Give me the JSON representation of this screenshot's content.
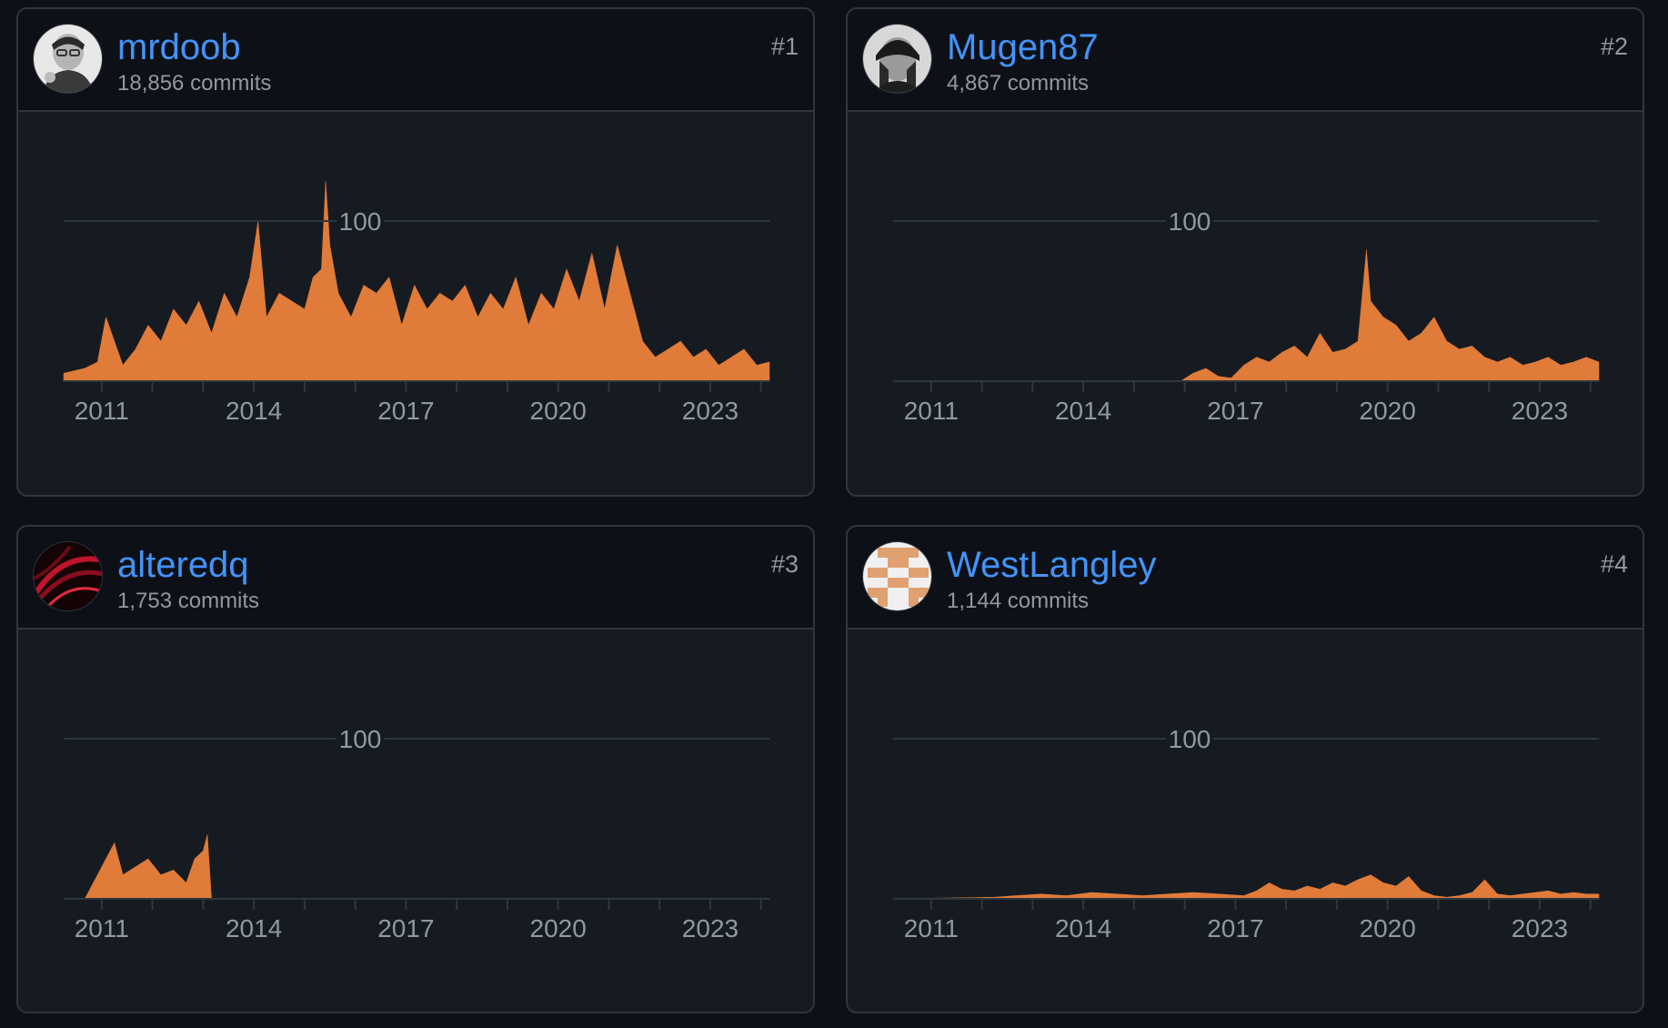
{
  "contributors": [
    {
      "rank": "#1",
      "username": "mrdoob",
      "commits": "18,856 commits",
      "avatar_icon": "avatar-photo-man-glasses"
    },
    {
      "rank": "#2",
      "username": "Mugen87",
      "commits": "4,867 commits",
      "avatar_icon": "avatar-photo-man-beanie"
    },
    {
      "rank": "#3",
      "username": "alteredq",
      "commits": "1,753 commits",
      "avatar_icon": "avatar-red-abstract"
    },
    {
      "rank": "#4",
      "username": "WestLangley",
      "commits": "1,144 commits",
      "avatar_icon": "avatar-identicon-orange"
    }
  ],
  "chart_data": [
    {
      "type": "area",
      "title": "mrdoob",
      "x_ticks": [
        "2011",
        "2014",
        "2017",
        "2020",
        "2023"
      ],
      "y_ticks": [
        "100"
      ],
      "ylim": [
        0,
        100
      ],
      "xlim": [
        "2010-04",
        "2024-03"
      ],
      "grid": true,
      "color": "#e07b39",
      "x": [
        "2010-04",
        "2010-09",
        "2010-12",
        "2011-02",
        "2011-06",
        "2011-09",
        "2011-12",
        "2012-03",
        "2012-06",
        "2012-09",
        "2012-12",
        "2013-03",
        "2013-06",
        "2013-09",
        "2013-12",
        "2014-02",
        "2014-04",
        "2014-07",
        "2014-10",
        "2015-01",
        "2015-03",
        "2015-05",
        "2015-06",
        "2015-07",
        "2015-09",
        "2015-12",
        "2016-03",
        "2016-06",
        "2016-09",
        "2016-12",
        "2017-03",
        "2017-06",
        "2017-09",
        "2017-12",
        "2018-03",
        "2018-06",
        "2018-09",
        "2018-12",
        "2019-03",
        "2019-06",
        "2019-09",
        "2019-12",
        "2020-03",
        "2020-06",
        "2020-09",
        "2020-12",
        "2021-03",
        "2021-06",
        "2021-09",
        "2021-12",
        "2022-03",
        "2022-06",
        "2022-09",
        "2022-12",
        "2023-03",
        "2023-06",
        "2023-09",
        "2023-12",
        "2024-03"
      ],
      "values": [
        5,
        8,
        12,
        40,
        10,
        20,
        35,
        25,
        45,
        35,
        50,
        30,
        55,
        40,
        65,
        100,
        40,
        55,
        50,
        45,
        65,
        70,
        125,
        85,
        55,
        40,
        60,
        55,
        65,
        35,
        60,
        45,
        55,
        50,
        60,
        40,
        55,
        45,
        65,
        35,
        55,
        45,
        70,
        50,
        80,
        45,
        85,
        55,
        25,
        15,
        20,
        25,
        15,
        20,
        10,
        15,
        20,
        10,
        12
      ]
    },
    {
      "type": "area",
      "title": "Mugen87",
      "x_ticks": [
        "2011",
        "2014",
        "2017",
        "2020",
        "2023"
      ],
      "y_ticks": [
        "100"
      ],
      "ylim": [
        0,
        100
      ],
      "xlim": [
        "2010-04",
        "2024-03"
      ],
      "grid": true,
      "color": "#e07b39",
      "x": [
        "2010-04",
        "2015-12",
        "2016-03",
        "2016-06",
        "2016-09",
        "2016-12",
        "2017-03",
        "2017-06",
        "2017-09",
        "2017-12",
        "2018-03",
        "2018-06",
        "2018-09",
        "2018-12",
        "2019-03",
        "2019-06",
        "2019-08",
        "2019-09",
        "2019-12",
        "2020-03",
        "2020-06",
        "2020-09",
        "2020-12",
        "2021-03",
        "2021-06",
        "2021-09",
        "2021-12",
        "2022-03",
        "2022-06",
        "2022-09",
        "2022-12",
        "2023-03",
        "2023-06",
        "2023-09",
        "2023-12",
        "2024-03"
      ],
      "values": [
        0,
        0,
        5,
        8,
        3,
        2,
        10,
        15,
        12,
        18,
        22,
        15,
        30,
        18,
        20,
        25,
        82,
        50,
        40,
        35,
        25,
        30,
        40,
        25,
        20,
        22,
        15,
        12,
        15,
        10,
        12,
        15,
        10,
        12,
        15,
        12
      ]
    },
    {
      "type": "area",
      "title": "alteredq",
      "x_ticks": [
        "2011",
        "2014",
        "2017",
        "2020",
        "2023"
      ],
      "y_ticks": [
        "100"
      ],
      "ylim": [
        0,
        100
      ],
      "xlim": [
        "2010-04",
        "2024-03"
      ],
      "grid": true,
      "color": "#e07b39",
      "x": [
        "2010-04",
        "2010-09",
        "2010-12",
        "2011-02",
        "2011-04",
        "2011-06",
        "2011-09",
        "2011-12",
        "2012-03",
        "2012-06",
        "2012-09",
        "2012-11",
        "2013-01",
        "2013-02",
        "2013-03",
        "2024-03"
      ],
      "values": [
        0,
        0,
        15,
        25,
        35,
        15,
        20,
        25,
        15,
        18,
        10,
        25,
        30,
        40,
        0,
        0
      ]
    },
    {
      "type": "area",
      "title": "WestLangley",
      "x_ticks": [
        "2011",
        "2014",
        "2017",
        "2020",
        "2023"
      ],
      "y_ticks": [
        "100"
      ],
      "ylim": [
        0,
        100
      ],
      "xlim": [
        "2010-04",
        "2024-03"
      ],
      "grid": true,
      "color": "#e07b39",
      "x": [
        "2010-04",
        "2012-04",
        "2012-09",
        "2013-03",
        "2013-09",
        "2014-03",
        "2014-09",
        "2015-03",
        "2015-09",
        "2016-03",
        "2016-09",
        "2017-03",
        "2017-06",
        "2017-09",
        "2017-12",
        "2018-03",
        "2018-06",
        "2018-09",
        "2018-12",
        "2019-03",
        "2019-06",
        "2019-09",
        "2019-12",
        "2020-03",
        "2020-06",
        "2020-09",
        "2020-12",
        "2021-03",
        "2021-06",
        "2021-09",
        "2021-12",
        "2022-03",
        "2022-06",
        "2022-09",
        "2022-12",
        "2023-03",
        "2023-06",
        "2023-09",
        "2023-12",
        "2024-03"
      ],
      "values": [
        0,
        1,
        2,
        3,
        2,
        4,
        3,
        2,
        3,
        4,
        3,
        2,
        5,
        10,
        6,
        5,
        8,
        6,
        10,
        8,
        12,
        15,
        10,
        8,
        14,
        5,
        2,
        1,
        2,
        4,
        12,
        3,
        2,
        3,
        4,
        5,
        3,
        4,
        3,
        3
      ]
    }
  ]
}
